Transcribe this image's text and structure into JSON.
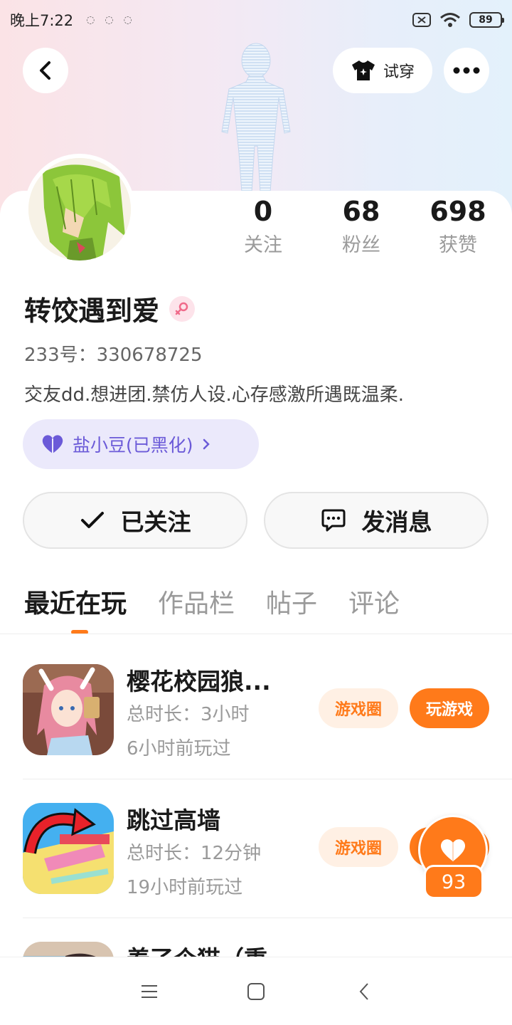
{
  "status_bar": {
    "time": "晚上7:22",
    "battery": "89"
  },
  "header": {
    "try_on_label": "试穿"
  },
  "stats": [
    {
      "value": "0",
      "label": "关注"
    },
    {
      "value": "68",
      "label": "粉丝"
    },
    {
      "value": "698",
      "label": "获赞"
    }
  ],
  "profile": {
    "name": "转饺遇到爱",
    "id_label": "233号：330678725",
    "bio": "交友dd.想进团.禁仿人设.心存感激所遇既温柔.",
    "tag_label": "盐小豆(已黑化)"
  },
  "actions": {
    "follow_label": "已关注",
    "message_label": "发消息"
  },
  "tabs": [
    "最近在玩",
    "作品栏",
    "帖子",
    "评论"
  ],
  "games": [
    {
      "title": "樱花校园狼...",
      "duration": "总时长：3小时",
      "last_played": "6小时前玩过",
      "circle_label": "游戏圈",
      "play_label": "玩游戏"
    },
    {
      "title": "跳过高墙",
      "duration": "总时长：12分钟",
      "last_played": "19小时前玩过",
      "circle_label": "游戏圈"
    },
    {
      "title": "养了个猫（重"
    }
  ],
  "like": {
    "count": "93"
  },
  "colors": {
    "accent": "#ff7a1a",
    "tag_bg": "#ebe9fb",
    "tag_text": "#6b5ad8"
  }
}
